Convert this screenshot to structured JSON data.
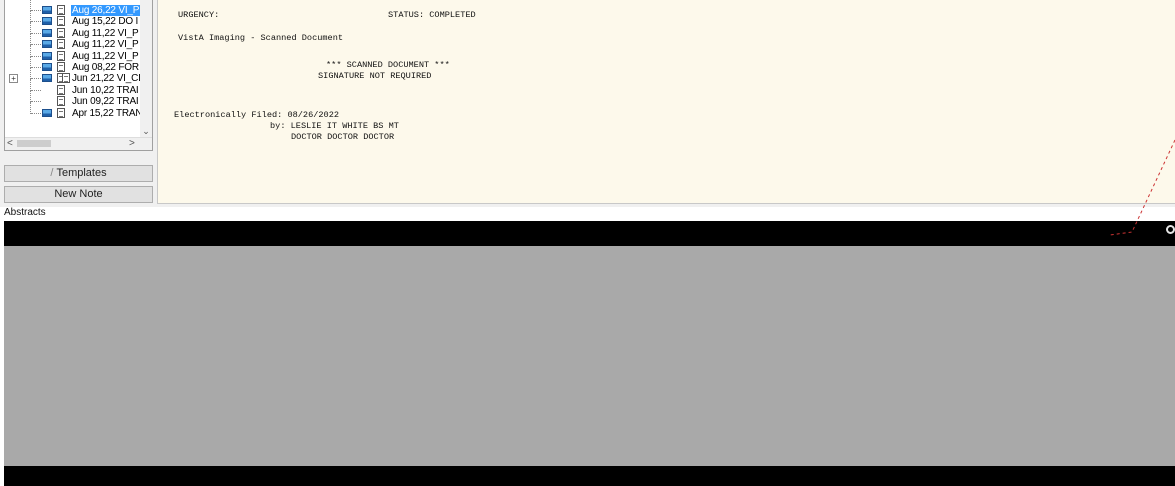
{
  "tree": {
    "items": [
      {
        "date": "Aug 26,22",
        "title": "VI_P",
        "icon": "image-document-icon",
        "selected": true
      },
      {
        "date": "Aug 15,22",
        "title": "DO I",
        "icon": "image-document-icon",
        "selected": false
      },
      {
        "date": "Aug 11,22",
        "title": "VI_P",
        "icon": "image-document-icon",
        "selected": false
      },
      {
        "date": "Aug 11,22",
        "title": "VI_P",
        "icon": "image-document-icon",
        "selected": false
      },
      {
        "date": "Aug 11,22",
        "title": "VI_P",
        "icon": "image-document-icon",
        "selected": false
      },
      {
        "date": "Aug 08,22",
        "title": "FOR",
        "icon": "image-document-icon",
        "selected": false
      },
      {
        "date": "Jun 21,22",
        "title": "VI_CI",
        "icon": "multi-image-document-icon",
        "selected": false,
        "expandable": true
      },
      {
        "date": "Jun 10,22",
        "title": "TRAI",
        "icon": "document-icon",
        "selected": false
      },
      {
        "date": "Jun 09,22",
        "title": "TRAI",
        "icon": "document-icon",
        "selected": false
      },
      {
        "date": "Apr 15,22",
        "title": "TRAN",
        "icon": "image-document-icon",
        "selected": false
      }
    ],
    "expander_symbol": "+",
    "scroll_left": "<",
    "scroll_right": ">",
    "scroll_down": "⌄"
  },
  "buttons": {
    "templates": "Templates",
    "templates_icon": "/",
    "new_note": "New Note"
  },
  "note": {
    "urgency_line": "URGENCY:",
    "status_line": "STATUS: COMPLETED",
    "doc_heading": "VistA Imaging - Scanned Document",
    "scanned_line": "*** SCANNED DOCUMENT ***",
    "signature_line": "SIGNATURE NOT REQUIRED",
    "filed_line": "Electronically Filed: 08/26/2022",
    "by_line": "by: LESLIE IT WHITE BS MT",
    "doctor_line": "DOCTOR DOCTOR DOCTOR"
  },
  "abstracts": {
    "label": "Abstracts",
    "gear_icon": "gear-icon"
  },
  "colors": {
    "selection": "#3399ff",
    "note_background": "#fdf9eb",
    "viewer_black": "#000000",
    "viewer_gray": "#a9a9a9",
    "annotation_line": "#cc3333"
  }
}
